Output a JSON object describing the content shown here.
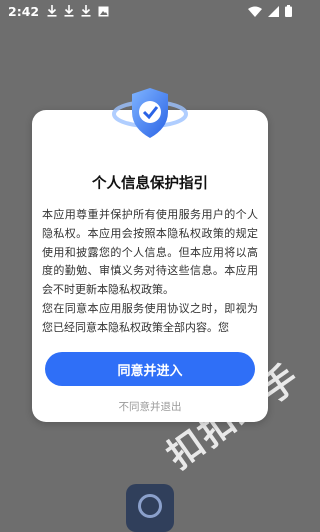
{
  "status_bar": {
    "time": "2:42",
    "left_icons": [
      "download-icon",
      "download-icon",
      "download-icon",
      "image-icon"
    ],
    "right_icons": [
      "wifi-icon",
      "signal-icon",
      "battery-icon"
    ]
  },
  "dialog": {
    "title": "个人信息保护指引",
    "body_paragraphs": [
      "本应用尊重并保护所有使用服务用户的个人隐私权。本应用会按照本隐私权政策的规定使用和披露您的个人信息。但本应用将以高度的勤勉、审慎义务对待这些信息。本应用会不时更新本隐私权政策。",
      "您在同意本应用服务使用协议之时，即视为您已经同意本隐私权政策全部内容。您"
    ],
    "agree_label": "同意并进入",
    "decline_label": "不同意并退出",
    "shield_icon": "shield-check-icon"
  },
  "background": {
    "watermark_text": "扣扣助手",
    "app_logo_icon": "app-logo-icon"
  },
  "colors": {
    "overlay": "#6e6e6e",
    "accent": "#2f6ff7",
    "decline_text": "#9a9a9a"
  }
}
